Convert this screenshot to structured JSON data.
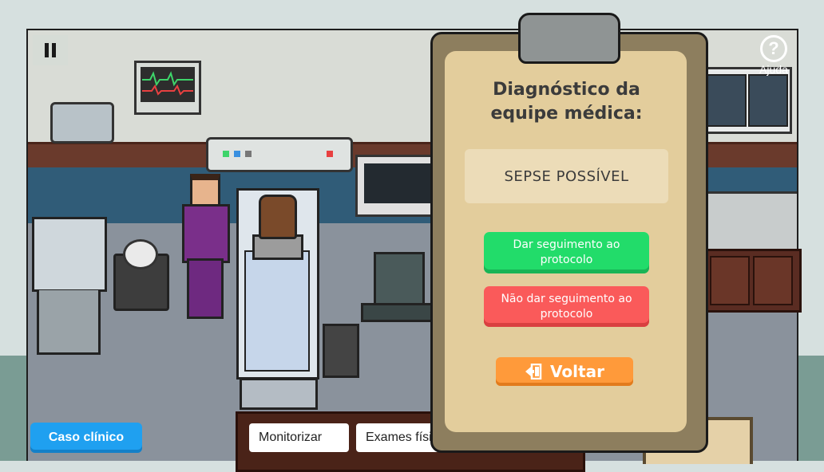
{
  "hud": {
    "help_label": "Ajuda",
    "help_glyph": "?"
  },
  "clipboard": {
    "title": "Diagnóstico da equipe médica:",
    "diagnosis": "SEPSE POSSÍVEL",
    "follow_label": "Dar seguimento ao protocolo",
    "not_follow_label": "Não dar seguimento ao protocolo",
    "back_label": "Voltar"
  },
  "bottom_bar": {
    "case_label": "Caso clínico",
    "menu": [
      "Monitorizar",
      "Exames físicos"
    ]
  },
  "colors": {
    "green_button": "#22dc6a",
    "red_button": "#fa5a5a",
    "orange_button": "#ff9a3a",
    "case_button": "#1fa0f0",
    "paper": "#e3cd9c"
  },
  "icons": {
    "pause": "pause-icon",
    "help": "help-icon",
    "back": "exit-door-icon"
  }
}
